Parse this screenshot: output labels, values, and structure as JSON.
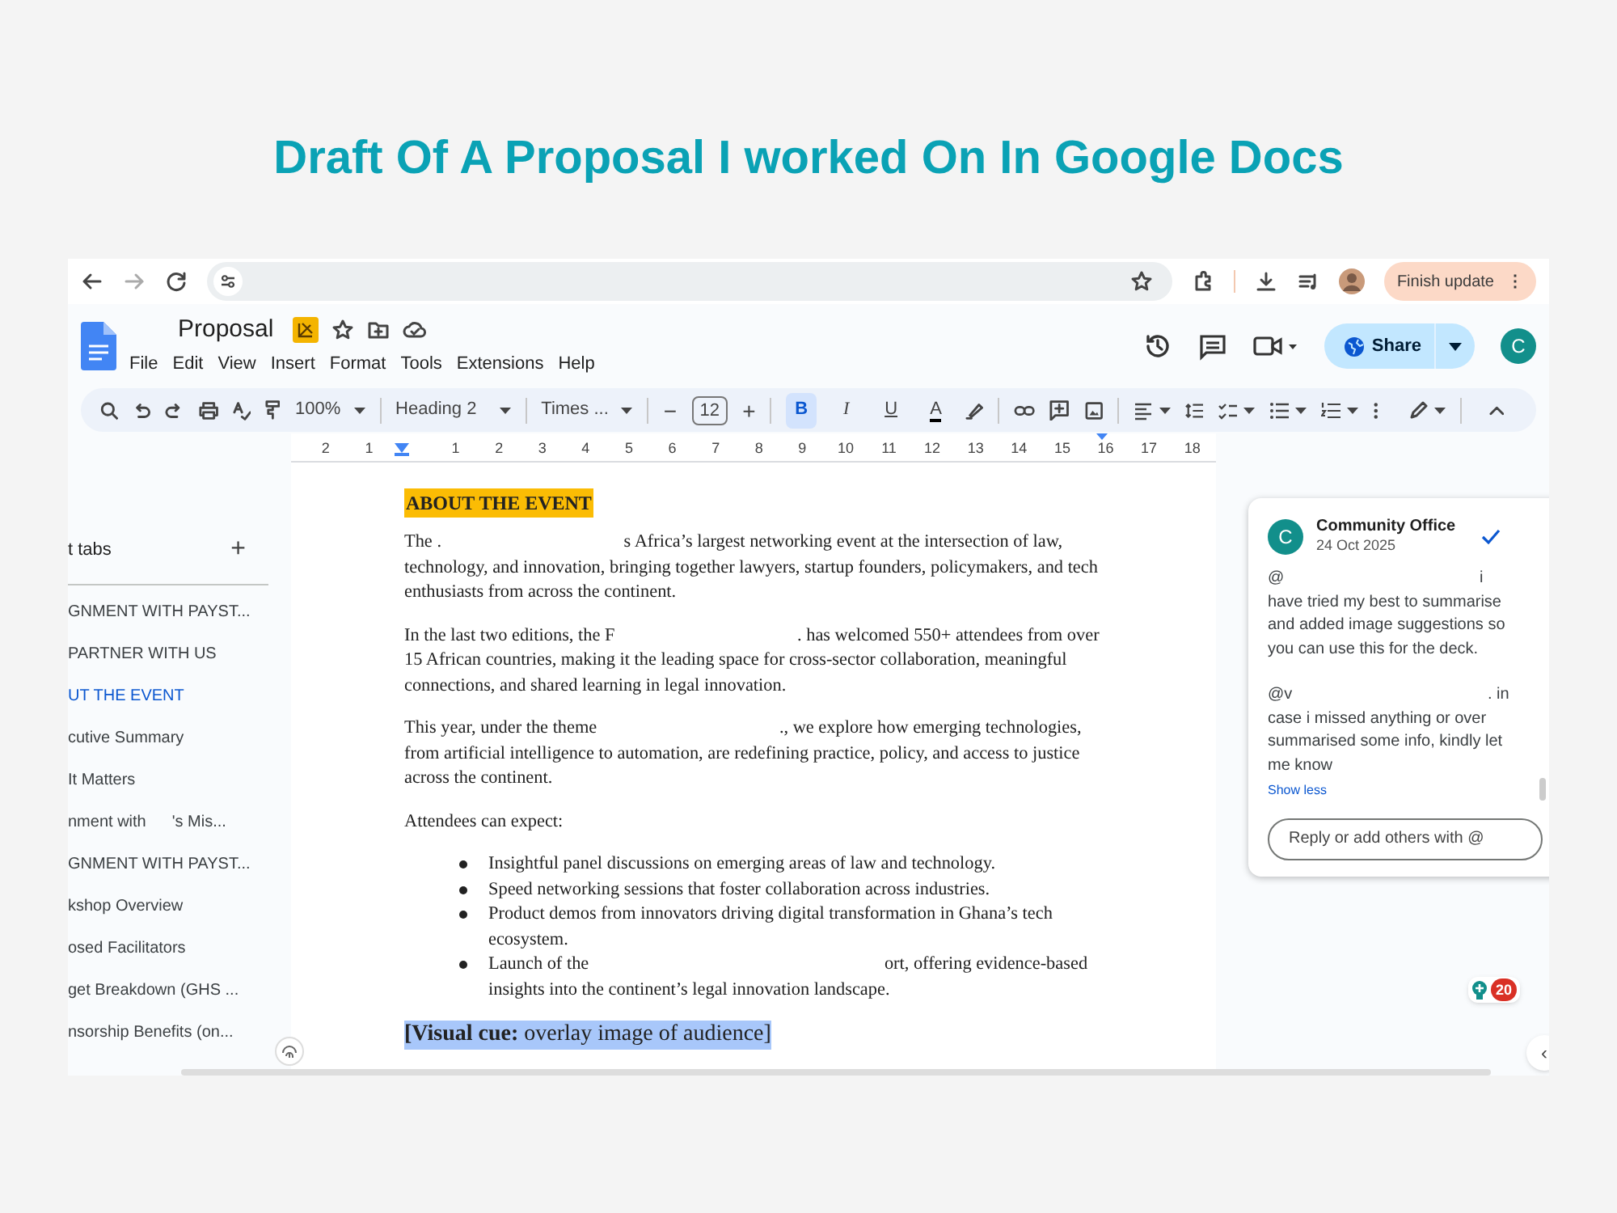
{
  "headline": "Draft Of A Proposal I worked On In Google Docs",
  "browser": {
    "update_button": "Finish update",
    "menu_glyph": "⋮"
  },
  "doc": {
    "title": "Proposal",
    "menus": [
      "File",
      "Edit",
      "View",
      "Insert",
      "Format",
      "Tools",
      "Extensions",
      "Help"
    ],
    "share": "Share",
    "avatar": "C"
  },
  "toolbar": {
    "zoom": "100%",
    "style": "Heading 2",
    "font": "Times ...",
    "size": "12",
    "minus": "−",
    "plus": "+",
    "formats": [
      {
        "kind": "bold",
        "label": "B",
        "selected": true
      },
      {
        "kind": "italic",
        "label": "I",
        "selected": false
      },
      {
        "kind": "underline",
        "label": "U",
        "selected": false
      },
      {
        "kind": "color",
        "label": "A",
        "selected": false
      }
    ]
  },
  "ruler": [
    "2",
    "1",
    "1",
    "2",
    "3",
    "4",
    "5",
    "6",
    "7",
    "8",
    "9",
    "10",
    "11",
    "12",
    "13",
    "14",
    "15",
    "16",
    "17",
    "18"
  ],
  "sidebar": {
    "header": "t tabs",
    "add": "+",
    "items": [
      {
        "label": "GNMENT WITH PAYST...",
        "selected": false
      },
      {
        "label": "PARTNER WITH US",
        "selected": false
      },
      {
        "label": "UT THE EVENT",
        "selected": true
      },
      {
        "label": "cutive Summary",
        "selected": false
      },
      {
        "label": "It Matters",
        "selected": false
      },
      {
        "label": "nment with",
        "label_2": "'s Mis...",
        "selected": false
      },
      {
        "label": "GNMENT WITH PAYST...",
        "selected": false
      },
      {
        "label": "kshop Overview",
        "selected": false
      },
      {
        "label": "osed Facilitators",
        "selected": false
      },
      {
        "label": "get Breakdown (GHS ...",
        "selected": false
      },
      {
        "label": "nsorship Benefits (on...",
        "selected": false
      }
    ]
  },
  "page": {
    "heading": "ABOUT THE EVENT",
    "paragraphs": [
      {
        "segments": [
          "The .",
          "s Africa’s largest networking event at the intersection of law, technology, and innovation, bringing together lawyers, startup founders, policymakers, and tech enthusiasts from across the continent."
        ]
      },
      {
        "segments": [
          "In the last two editions, the F",
          ". has welcomed 550+ attendees from over 15 African countries, making it the leading space for cross-sector collaboration, meaningful connections, and shared learning in legal innovation."
        ]
      },
      {
        "segments": [
          "This year, under the theme",
          "., we explore how emerging technologies, from artificial intelligence to automation, are redefining practice, policy, and access to justice across the continent."
        ]
      },
      {
        "segments": [
          "Attendees can expect:"
        ]
      }
    ],
    "bullets": [
      {
        "segments": [
          "Insightful panel discussions on emerging areas of law and technology."
        ]
      },
      {
        "segments": [
          "Speed networking sessions that foster collaboration across industries."
        ]
      },
      {
        "segments": [
          "Product demos from innovators driving digital transformation in Ghana’s tech ecosystem."
        ]
      },
      {
        "segments": [
          "Launch of the",
          "ort, offering evidence-based insights into the continent’s legal innovation landscape."
        ]
      }
    ],
    "cue": "**[Visual cue:** overlay image of audience]"
  },
  "comment": {
    "author": "Community Office",
    "avatar": "C",
    "date": "24 Oct 2025",
    "paragraphs": [
      {
        "segments": [
          "@",
          "i have tried my best to summarise and added image suggestions so you can use this for the deck."
        ]
      },
      {
        "segments": [
          "@v",
          ". in case i missed anything or over summarised some info, kindly let me know"
        ]
      }
    ],
    "toggle": "Show less",
    "reply_placeholder": "Reply or add others with @"
  },
  "badge": {
    "count": "20"
  },
  "collapse_glyph": "‹"
}
